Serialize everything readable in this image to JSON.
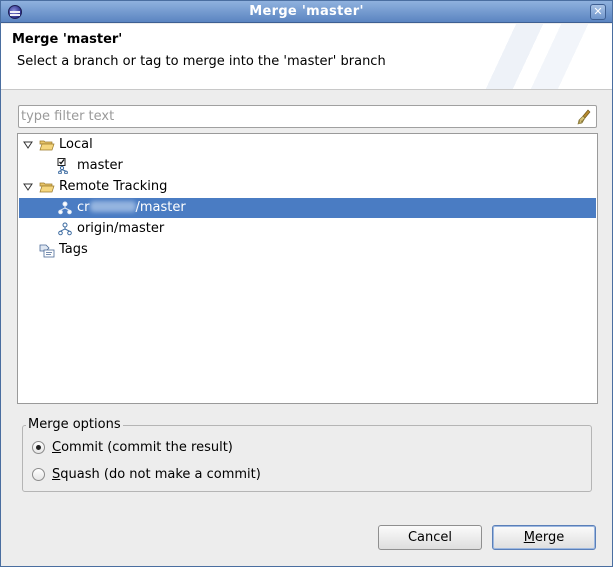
{
  "window": {
    "title": "Merge 'master'"
  },
  "header": {
    "title": "Merge 'master'",
    "message": "Select a branch or tag to merge into the 'master' branch"
  },
  "filter": {
    "placeholder": "type filter text",
    "value": ""
  },
  "tree": {
    "local_label": "Local",
    "local_branch": "master",
    "remote_label": "Remote Tracking",
    "remote_branch_1_prefix": "cr",
    "remote_branch_1_suffix": "/master",
    "remote_branch_2": "origin/master",
    "tags_label": "Tags"
  },
  "merge_options": {
    "legend": "Merge options",
    "commit_mnemonic": "C",
    "commit_rest": "ommit (commit the result)",
    "squash_mnemonic": "S",
    "squash_rest": "quash (do not make a commit)",
    "selected": "commit"
  },
  "buttons": {
    "cancel": "Cancel",
    "merge_mnemonic": "M",
    "merge_rest": "erge"
  },
  "colors": {
    "selection": "#4a7cc3",
    "titlebar": "#5b85c1"
  }
}
